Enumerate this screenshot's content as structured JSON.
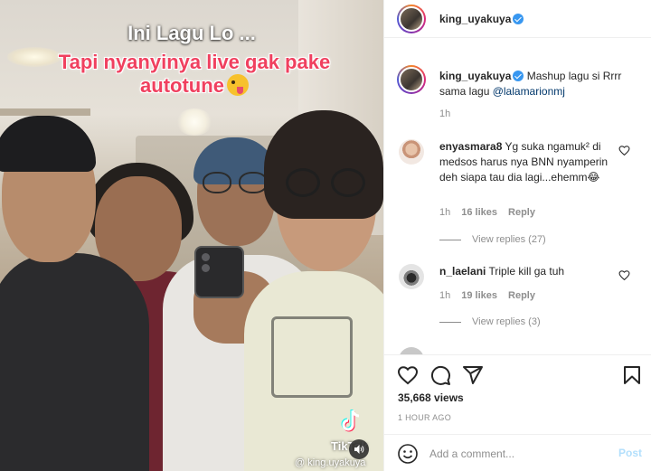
{
  "video": {
    "overlay_line1": "Ini Lagu Lo ...",
    "overlay_line2": "Tapi nyanyinya live gak pake autotune",
    "tiktok_watermark": "TikTok",
    "tiktok_handle": "@ king.uyakuya"
  },
  "post": {
    "author": "king_uyakuya",
    "caption_author": "king_uyakuya",
    "caption_text": "Mashup lagu si Rrrr sama lagu ",
    "caption_mention": "@lalamarionmj",
    "caption_time": "1h",
    "views": "35,668 views",
    "posted": "1 HOUR AGO"
  },
  "comments": [
    {
      "username": "enyasmara8",
      "text": "Yg suka ngamuk² di medsos harus nya BNN nyamperin deh siapa tau dia lagi...ehemm😂",
      "time": "1h",
      "likes": "16 likes",
      "reply": "Reply",
      "view_replies": "View replies (27)"
    },
    {
      "username": "n_laelani",
      "text": "Triple kill ga tuh",
      "time": "1h",
      "likes": "19 likes",
      "reply": "Reply",
      "view_replies": "View replies (3)"
    }
  ],
  "add_comment": {
    "placeholder": "Add a comment...",
    "post_label": "Post"
  },
  "icons": {
    "like": "heart-icon",
    "comment": "comment-icon",
    "share": "paper-plane-icon",
    "save": "bookmark-icon",
    "emoji": "smile-icon",
    "mute": "speaker-icon"
  },
  "colors": {
    "overlay_accent": "#f0405f",
    "link": "#00376b",
    "verified": "#3897f0",
    "post_disabled": "#b2dffc"
  }
}
